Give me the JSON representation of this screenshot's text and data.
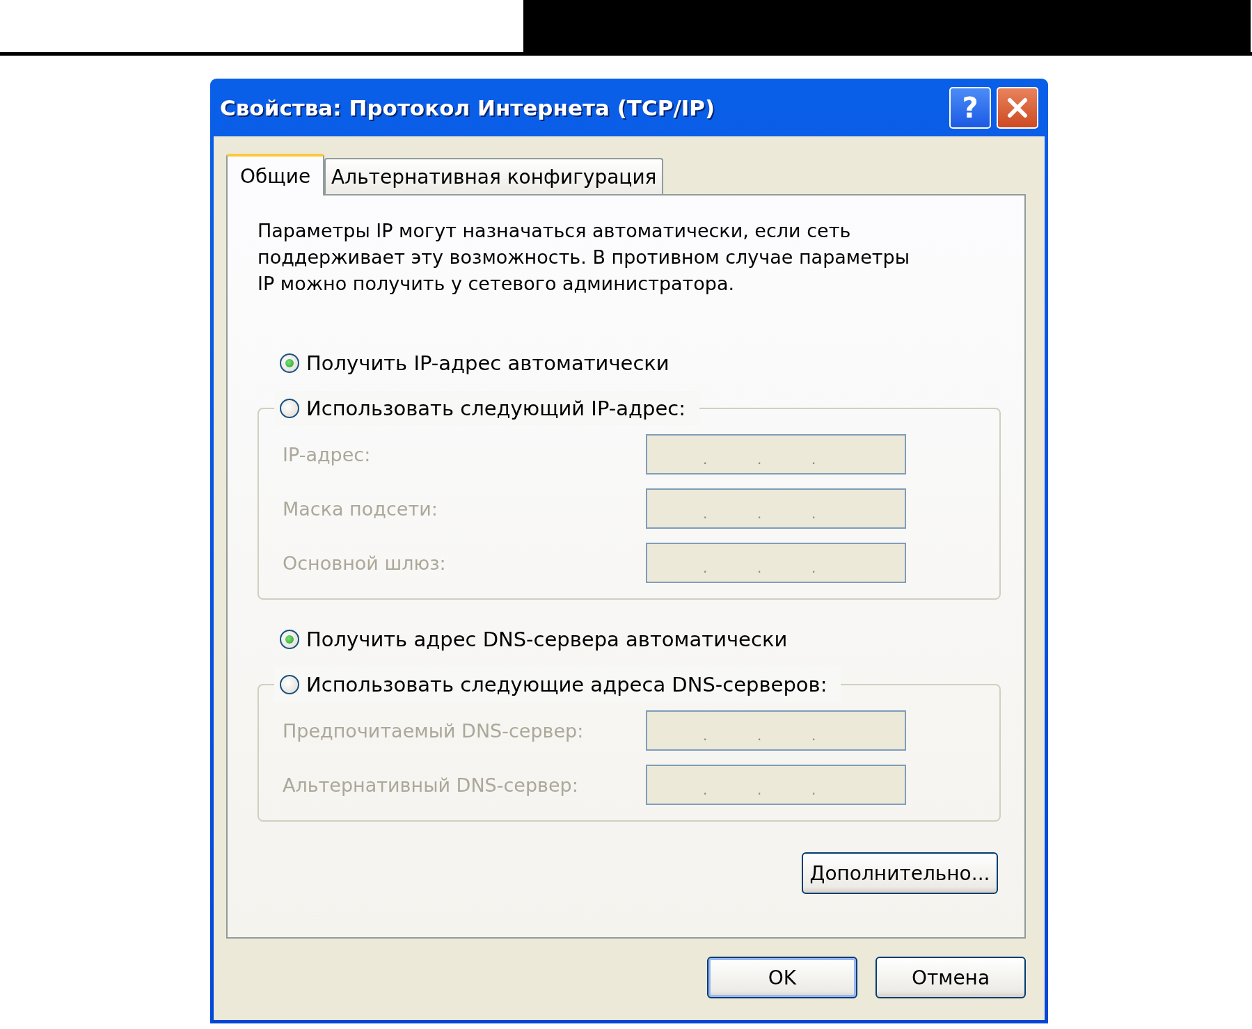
{
  "window": {
    "title": "Свойства: Протокол Интернета (TCP/IP)",
    "help_button": "?"
  },
  "tabs": [
    {
      "label": "Общие",
      "selected": true
    },
    {
      "label": "Альтернативная конфигурация",
      "selected": false
    }
  ],
  "description": "Параметры IP могут назначаться автоматически, если сеть поддерживает эту возможность. В противном случае параметры IP можно получить у сетевого администратора.",
  "groups": [
    {
      "options": [
        {
          "label": "Получить IP-адрес автоматически",
          "selected": true
        },
        {
          "label": "Использовать следующий IP-адрес:",
          "selected": false
        }
      ],
      "fields": [
        {
          "label": "IP-адрес:",
          "disabled": true,
          "dots": [
            ".",
            ".",
            "."
          ]
        },
        {
          "label": "Маска подсети:",
          "disabled": true,
          "dots": [
            ".",
            ".",
            "."
          ]
        },
        {
          "label": "Основной шлюз:",
          "disabled": true,
          "dots": [
            ".",
            ".",
            "."
          ]
        }
      ]
    },
    {
      "options": [
        {
          "label": "Получить адрес DNS-сервера автоматически",
          "selected": true
        },
        {
          "label": "Использовать следующие адреса DNS-серверов:",
          "selected": false
        }
      ],
      "fields": [
        {
          "label": "Предпочитаемый DNS-сервер:",
          "disabled": true,
          "dots": [
            ".",
            ".",
            "."
          ]
        },
        {
          "label": "Альтернативный DNS-сервер:",
          "disabled": true,
          "dots": [
            ".",
            ".",
            "."
          ]
        }
      ]
    }
  ],
  "advanced_button": "Дополнительно...",
  "buttons": [
    {
      "label": "OK",
      "default": true
    },
    {
      "label": "Отмена",
      "default": false
    }
  ]
}
